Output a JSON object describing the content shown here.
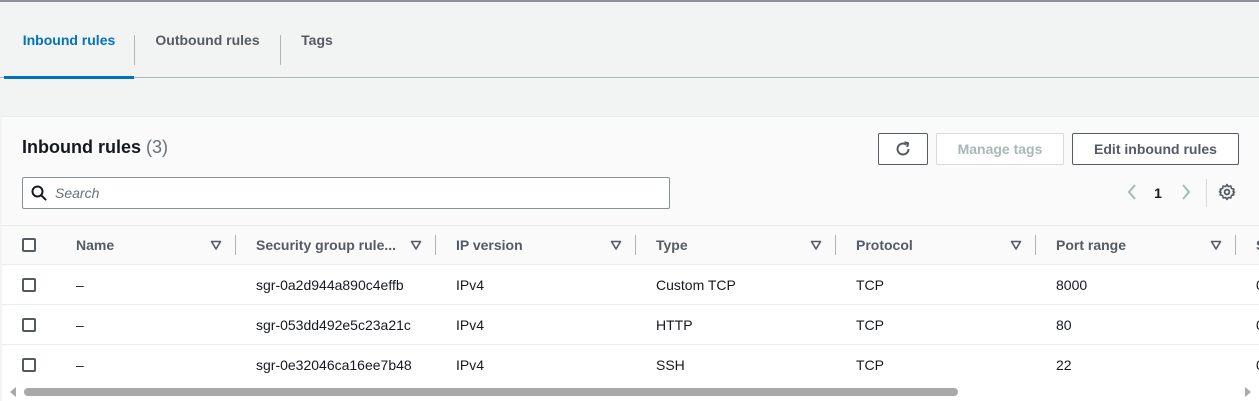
{
  "tabs": [
    {
      "label": "Inbound rules",
      "active": true
    },
    {
      "label": "Outbound rules",
      "active": false
    },
    {
      "label": "Tags",
      "active": false
    }
  ],
  "panel": {
    "title": "Inbound rules",
    "count": "(3)",
    "buttons": {
      "refresh_icon": "refresh-icon",
      "manage_tags": "Manage tags",
      "edit_inbound_rules": "Edit inbound rules"
    },
    "search": {
      "placeholder": "Search",
      "value": ""
    },
    "pagination": {
      "current_page": "1"
    }
  },
  "table": {
    "columns": [
      "Name",
      "Security group rule...",
      "IP version",
      "Type",
      "Protocol",
      "Port range",
      "S"
    ],
    "rows": [
      {
        "name": "–",
        "rule_id": "sgr-0a2d944a890c4effb",
        "ip_version": "IPv4",
        "type": "Custom TCP",
        "protocol": "TCP",
        "port_range": "8000",
        "extra": "0"
      },
      {
        "name": "–",
        "rule_id": "sgr-053dd492e5c23a21c",
        "ip_version": "IPv4",
        "type": "HTTP",
        "protocol": "TCP",
        "port_range": "80",
        "extra": "0"
      },
      {
        "name": "–",
        "rule_id": "sgr-0e32046ca16ee7b48",
        "ip_version": "IPv4",
        "type": "SSH",
        "protocol": "TCP",
        "port_range": "22",
        "extra": "0"
      }
    ]
  },
  "colors": {
    "accent": "#0073bb",
    "text": "#16191f",
    "muted": "#545b64",
    "disabled": "#aab7b8"
  }
}
